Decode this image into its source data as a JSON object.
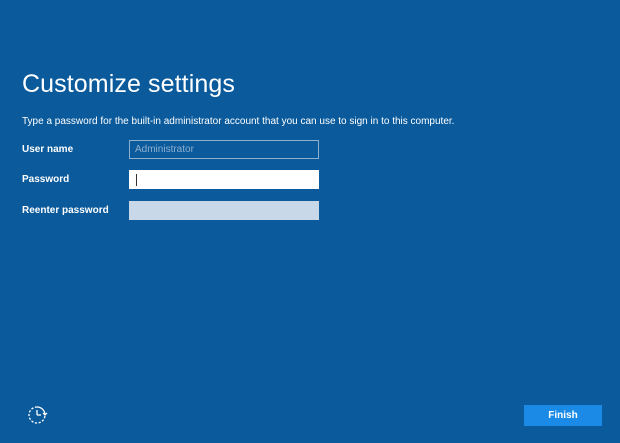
{
  "page": {
    "title": "Customize settings",
    "subtitle": "Type a password for the built-in administrator account that you can use to sign in to this computer."
  },
  "form": {
    "user_name": {
      "label": "User name",
      "placeholder": "Administrator",
      "value": ""
    },
    "password": {
      "label": "Password",
      "value": ""
    },
    "reenter_password": {
      "label": "Reenter password",
      "value": ""
    }
  },
  "footer": {
    "accessibility_icon": "ease-of-access-icon",
    "finish_label": "Finish"
  },
  "colors": {
    "background": "#0a5a9c",
    "accent_button": "#1a8ae6",
    "text": "#ffffff"
  }
}
